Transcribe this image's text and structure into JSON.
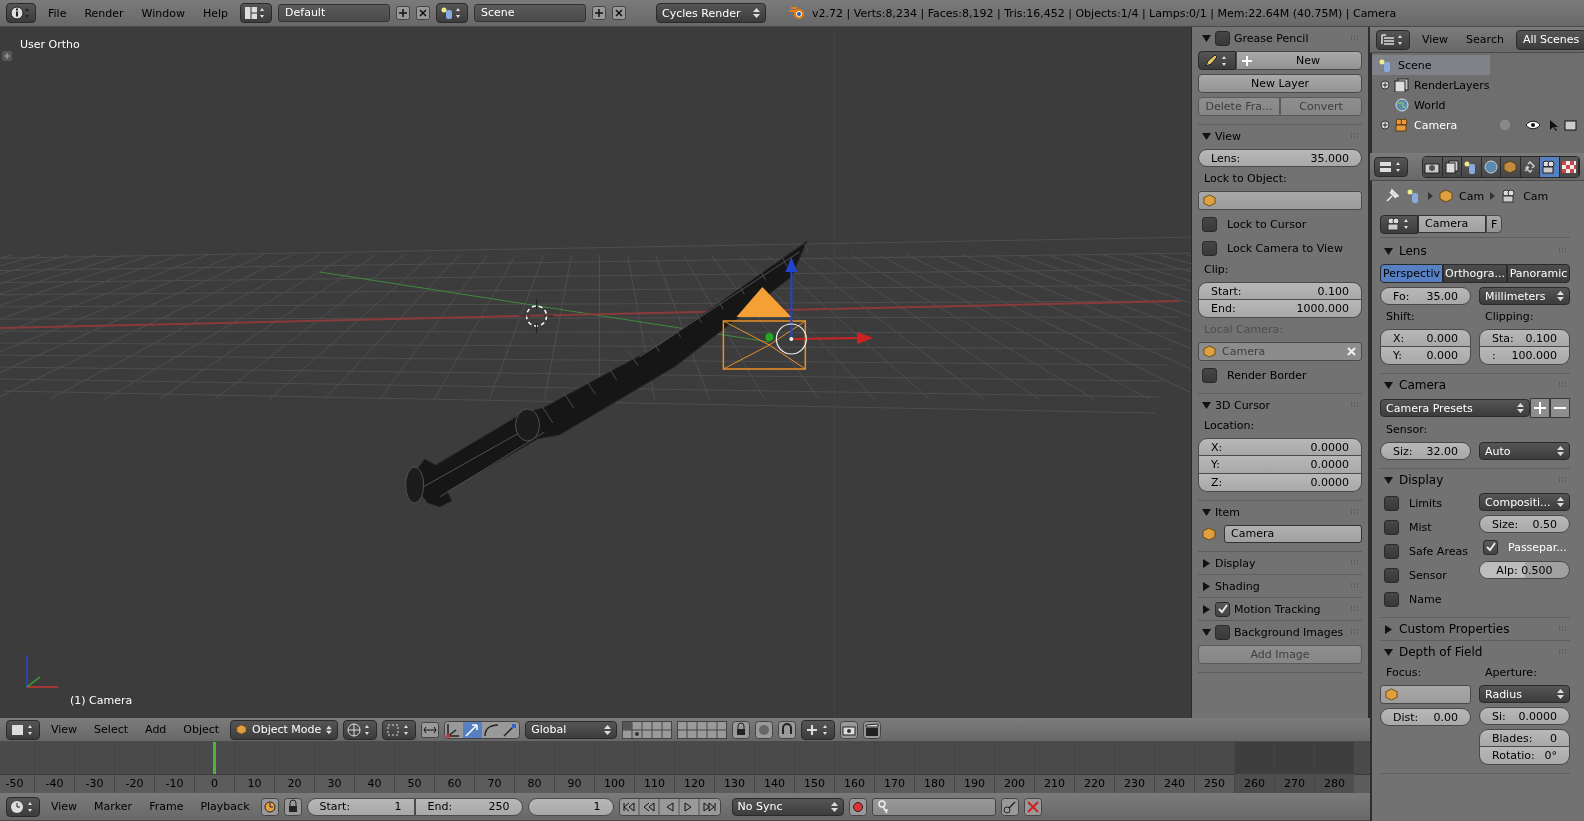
{
  "top_bar": {
    "menus": [
      "File",
      "Render",
      "Window",
      "Help"
    ],
    "screen_layout": "Default",
    "scene": "Scene",
    "render_engine": "Cycles Render",
    "stats": "v2.72 | Verts:8,234 | Faces:8,192 | Tris:16,452 | Objects:1/4 | Lamps:0/1 | Mem:22.64M (40.75M) | Camera"
  },
  "viewport": {
    "view_label": "User Ortho",
    "object_label": "(1) Camera"
  },
  "viewport_header": {
    "menus": [
      "View",
      "Select",
      "Add",
      "Object"
    ],
    "mode": "Object Mode",
    "orientation": "Global"
  },
  "outliner": {
    "menus": [
      "View",
      "Search"
    ],
    "display_mode": "All Scenes",
    "tree": [
      {
        "label": "Scene",
        "kind": "scene",
        "selected": true,
        "children": [
          {
            "label": "RenderLayers",
            "kind": "layers",
            "selected": false,
            "expanded": false
          },
          {
            "label": "World",
            "kind": "world",
            "selected": false
          },
          {
            "label": "Camera",
            "kind": "camera",
            "selected": false,
            "expanded": false
          }
        ]
      }
    ]
  },
  "properties": {
    "tabs": [
      {
        "kind": "render",
        "selected": false
      },
      {
        "kind": "layers",
        "selected": false
      },
      {
        "kind": "scene",
        "selected": false
      },
      {
        "kind": "world",
        "selected": false
      },
      {
        "kind": "object",
        "selected": false
      },
      {
        "kind": "constraint",
        "selected": false
      },
      {
        "kind": "camera",
        "selected": true
      },
      {
        "kind": "texture",
        "selected": false
      }
    ],
    "breadcrumb": [
      "Cam",
      "Cam"
    ],
    "datablock": {
      "name": "Camera",
      "fake_user": "F"
    },
    "sections": [
      {
        "title": "Lens",
        "expanded": true,
        "rows": [
          {
            "kind": "enum",
            "items": [
              {
                "text": "Perspectiv",
                "selected": true
              },
              {
                "text": "Orthogra...",
                "selected": false
              },
              {
                "text": "Panoramic",
                "selected": false
              }
            ]
          },
          {
            "kind": "cols",
            "cols": [
              [
                {
                  "kind": "num",
                  "label": "Fo:",
                  "value": "35.00"
                }
              ],
              [
                {
                  "kind": "menu",
                  "text": "Millimeters"
                }
              ]
            ]
          },
          {
            "kind": "cols",
            "cols": [
              [
                {
                  "kind": "label",
                  "text": "Shift:"
                },
                {
                  "kind": "numgroup",
                  "items": [
                    {
                      "label": "X:",
                      "value": "0.000"
                    },
                    {
                      "label": "Y:",
                      "value": "0.000"
                    }
                  ]
                }
              ],
              [
                {
                  "kind": "label",
                  "text": "Clipping:"
                },
                {
                  "kind": "numgroup",
                  "items": [
                    {
                      "label": "Sta:",
                      "value": "0.100"
                    },
                    {
                      "label": ":",
                      "value": "100.000"
                    }
                  ]
                }
              ]
            ]
          }
        ]
      },
      {
        "title": "Camera",
        "expanded": true,
        "rows": [
          {
            "kind": "preset",
            "text": "Camera Presets"
          },
          {
            "kind": "label",
            "text": "Sensor:"
          },
          {
            "kind": "cols",
            "cols": [
              [
                {
                  "kind": "num",
                  "label": "Siz:",
                  "value": "32.00"
                }
              ],
              [
                {
                  "kind": "menu",
                  "text": "Auto"
                }
              ]
            ]
          }
        ]
      },
      {
        "title": "Display",
        "expanded": true,
        "rows": [
          {
            "kind": "cols",
            "cols": [
              [
                {
                  "kind": "check",
                  "label": "Limits",
                  "checked": false
                },
                {
                  "kind": "check",
                  "label": "Mist",
                  "checked": false
                },
                {
                  "kind": "check",
                  "label": "Safe Areas",
                  "checked": false
                },
                {
                  "kind": "check",
                  "label": "Sensor",
                  "checked": false
                },
                {
                  "kind": "check",
                  "label": "Name",
                  "checked": false
                }
              ],
              [
                {
                  "kind": "menu",
                  "text": "Compositi..."
                },
                {
                  "kind": "num",
                  "label": "Size:",
                  "value": "0.50"
                },
                {
                  "kind": "check",
                  "label": "Passepar...",
                  "checked": true
                },
                {
                  "kind": "slider",
                  "label": "Alp:",
                  "value": "0.500",
                  "level": 0.5
                }
              ]
            ]
          }
        ]
      },
      {
        "title": "Custom Properties",
        "expanded": false
      },
      {
        "title": "Depth of Field",
        "expanded": true,
        "rows": [
          {
            "kind": "cols",
            "cols": [
              [
                {
                  "kind": "label",
                  "text": "Focus:"
                },
                {
                  "kind": "object",
                  "disabled": false
                },
                {
                  "kind": "num",
                  "label": "Dist:",
                  "value": "0.00"
                }
              ],
              [
                {
                  "kind": "label",
                  "text": "Aperture:"
                },
                {
                  "kind": "menu",
                  "text": "Radius"
                },
                {
                  "kind": "num",
                  "label": "Si:",
                  "value": "0.0000"
                },
                {
                  "kind": "numgroup",
                  "items": [
                    {
                      "label": "Blades:",
                      "value": "0"
                    },
                    {
                      "label": "Rotatio:",
                      "value": "0°"
                    }
                  ]
                }
              ]
            ]
          }
        ]
      }
    ]
  },
  "n_panel": {
    "sections": [
      {
        "title": "Grease Pencil",
        "expanded": true,
        "checkbox": {
          "checked": false
        },
        "rows": [
          {
            "kind": "new_block",
            "text": "New"
          },
          {
            "kind": "button",
            "text": "New Layer",
            "disabled": false
          },
          {
            "kind": "buttons",
            "items": [
              {
                "text": "Delete Fra...",
                "disabled": true
              },
              {
                "text": "Convert",
                "disabled": true
              }
            ]
          }
        ]
      },
      {
        "title": "View",
        "expanded": true,
        "rows": [
          {
            "kind": "num",
            "label": "Lens:",
            "value": "35.000"
          },
          {
            "kind": "label",
            "text": "Lock to Object:",
            "disabled": false
          },
          {
            "kind": "object",
            "disabled": false
          },
          {
            "kind": "check",
            "label": "Lock to Cursor",
            "checked": false
          },
          {
            "kind": "check",
            "label": "Lock Camera to View",
            "checked": false
          },
          {
            "kind": "label",
            "text": "Clip:",
            "disabled": false
          },
          {
            "kind": "numgroup",
            "items": [
              {
                "label": "Start:",
                "value": "0.100"
              },
              {
                "label": "End:",
                "value": "1000.000"
              }
            ]
          },
          {
            "kind": "label",
            "text": "Local Camera:",
            "disabled": true
          },
          {
            "kind": "object",
            "value": "Camera",
            "disabled": true,
            "clear": true
          },
          {
            "kind": "check",
            "label": "Render Border",
            "checked": false
          }
        ]
      },
      {
        "title": "3D Cursor",
        "expanded": true,
        "rows": [
          {
            "kind": "label",
            "text": "Location:",
            "disabled": false
          },
          {
            "kind": "numgroup",
            "items": [
              {
                "label": "X:",
                "value": "0.0000"
              },
              {
                "label": "Y:",
                "value": "0.0000"
              },
              {
                "label": "Z:",
                "value": "0.0000"
              }
            ]
          }
        ]
      },
      {
        "title": "Item",
        "expanded": true,
        "rows": [
          {
            "kind": "item_name",
            "text": "Camera"
          }
        ]
      },
      {
        "title": "Display",
        "expanded": false
      },
      {
        "title": "Shading",
        "expanded": false
      },
      {
        "title": "Motion Tracking",
        "expanded": false,
        "checkbox": {
          "checked": true
        }
      },
      {
        "title": "Background Images",
        "expanded": true,
        "checkbox": {
          "checked": false
        },
        "rows": [
          {
            "kind": "button",
            "text": "Add Image",
            "disabled": true
          }
        ]
      }
    ]
  },
  "timeline": {
    "ticks": [
      {
        "label": "-50",
        "selected": false,
        "in_range": true
      },
      {
        "label": "-40",
        "selected": false,
        "in_range": true
      },
      {
        "label": "-30",
        "selected": false,
        "in_range": true
      },
      {
        "label": "-20",
        "selected": false,
        "in_range": true
      },
      {
        "label": "-10",
        "selected": false,
        "in_range": true
      },
      {
        "label": "0",
        "selected": true,
        "in_range": true
      },
      {
        "label": "10",
        "selected": false,
        "in_range": true
      },
      {
        "label": "20",
        "selected": false,
        "in_range": true
      },
      {
        "label": "30",
        "selected": false,
        "in_range": true
      },
      {
        "label": "40",
        "selected": false,
        "in_range": true
      },
      {
        "label": "50",
        "selected": false,
        "in_range": true
      },
      {
        "label": "60",
        "selected": false,
        "in_range": true
      },
      {
        "label": "70",
        "selected": false,
        "in_range": true
      },
      {
        "label": "80",
        "selected": false,
        "in_range": true
      },
      {
        "label": "90",
        "selected": false,
        "in_range": true
      },
      {
        "label": "100",
        "selected": false,
        "in_range": true
      },
      {
        "label": "110",
        "selected": false,
        "in_range": true
      },
      {
        "label": "120",
        "selected": false,
        "in_range": true
      },
      {
        "label": "130",
        "selected": false,
        "in_range": true
      },
      {
        "label": "140",
        "selected": false,
        "in_range": true
      },
      {
        "label": "150",
        "selected": false,
        "in_range": true
      },
      {
        "label": "160",
        "selected": false,
        "in_range": true
      },
      {
        "label": "170",
        "selected": false,
        "in_range": true
      },
      {
        "label": "180",
        "selected": false,
        "in_range": true
      },
      {
        "label": "190",
        "selected": false,
        "in_range": true
      },
      {
        "label": "200",
        "selected": false,
        "in_range": true
      },
      {
        "label": "210",
        "selected": false,
        "in_range": true
      },
      {
        "label": "220",
        "selected": false,
        "in_range": true
      },
      {
        "label": "230",
        "selected": false,
        "in_range": true
      },
      {
        "label": "240",
        "selected": false,
        "in_range": true
      },
      {
        "label": "250",
        "selected": false,
        "in_range": true
      },
      {
        "label": "260",
        "selected": false,
        "in_range": false
      },
      {
        "label": "270",
        "selected": false,
        "in_range": false
      },
      {
        "label": "280",
        "selected": false,
        "in_range": false
      }
    ]
  },
  "timeline_header": {
    "menus": [
      "View",
      "Marker",
      "Frame",
      "Playback"
    ],
    "start": {
      "label": "Start:",
      "value": "1"
    },
    "end": {
      "label": "End:",
      "value": "250"
    },
    "current_frame": "1",
    "sync": "No Sync"
  }
}
